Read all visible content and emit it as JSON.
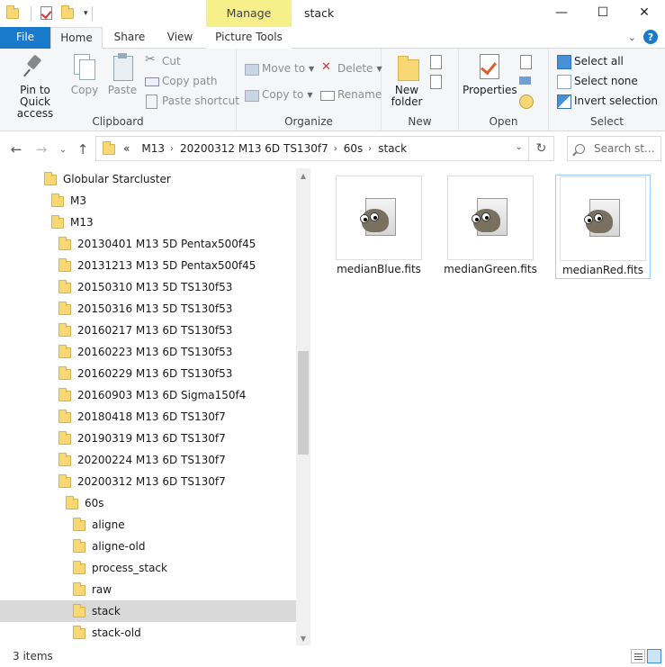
{
  "window": {
    "title": "stack",
    "context_tab": "Manage",
    "controls": {
      "minimize": "—",
      "maximize": "☐",
      "close": "✕"
    }
  },
  "ribbon_tabs": {
    "file": "File",
    "home": "Home",
    "share": "Share",
    "view": "View",
    "picture_tools": "Picture Tools"
  },
  "ribbon": {
    "clipboard": {
      "label": "Clipboard",
      "pin": "Pin to Quick access",
      "copy": "Copy",
      "paste": "Paste",
      "cut": "Cut",
      "copy_path": "Copy path",
      "paste_shortcut": "Paste shortcut"
    },
    "organize": {
      "label": "Organize",
      "move_to": "Move to",
      "copy_to": "Copy to",
      "delete": "Delete",
      "rename": "Rename"
    },
    "new": {
      "label": "New",
      "new_folder": "New folder"
    },
    "open": {
      "label": "Open",
      "properties": "Properties"
    },
    "select": {
      "label": "Select",
      "select_all": "Select all",
      "select_none": "Select none",
      "invert_selection": "Invert selection"
    }
  },
  "address": {
    "overflow": "«",
    "crumbs": [
      "M13",
      "20200312 M13 6D TS130f7",
      "60s",
      "stack"
    ],
    "search_placeholder": "Search st..."
  },
  "tree": [
    {
      "label": "Globular Starcluster",
      "indent": 0
    },
    {
      "label": "M3",
      "indent": 1
    },
    {
      "label": "M13",
      "indent": 1
    },
    {
      "label": "20130401 M13 5D Pentax500f45",
      "indent": 2
    },
    {
      "label": "20131213 M13 5D Pentax500f45",
      "indent": 2
    },
    {
      "label": "20150310 M13 5D TS130f53",
      "indent": 2
    },
    {
      "label": "20150316 M13 5D TS130f53",
      "indent": 2
    },
    {
      "label": "20160217 M13 6D TS130f53",
      "indent": 2
    },
    {
      "label": "20160223 M13 6D TS130f53",
      "indent": 2
    },
    {
      "label": "20160229 M13 6D TS130f53",
      "indent": 2
    },
    {
      "label": "20160903 M13 6D Sigma150f4",
      "indent": 2
    },
    {
      "label": "20180418 M13 6D TS130f7",
      "indent": 2
    },
    {
      "label": "20190319 M13 6D TS130f7",
      "indent": 2
    },
    {
      "label": "20200224 M13 6D TS130f7",
      "indent": 2
    },
    {
      "label": "20200312 M13 6D TS130f7",
      "indent": 2
    },
    {
      "label": "60s",
      "indent": 3
    },
    {
      "label": "aligne",
      "indent": 4
    },
    {
      "label": "aligne-old",
      "indent": 4
    },
    {
      "label": "process_stack",
      "indent": 4
    },
    {
      "label": "raw",
      "indent": 4
    },
    {
      "label": "stack",
      "indent": 4,
      "selected": true
    },
    {
      "label": "stack-old",
      "indent": 4
    }
  ],
  "files": [
    {
      "name": "medianBlue.fits",
      "icon": "gimp-file-icon"
    },
    {
      "name": "medianGreen.fits",
      "icon": "gimp-file-icon"
    },
    {
      "name": "medianRed.fits",
      "icon": "gimp-file-icon",
      "selected": true
    }
  ],
  "status": {
    "item_count": "3 items"
  },
  "colors": {
    "file_tab": "#1979ca",
    "manage_tab": "#f6ef8a",
    "folder": "#f8d775",
    "selection": "#d9d9d9"
  }
}
